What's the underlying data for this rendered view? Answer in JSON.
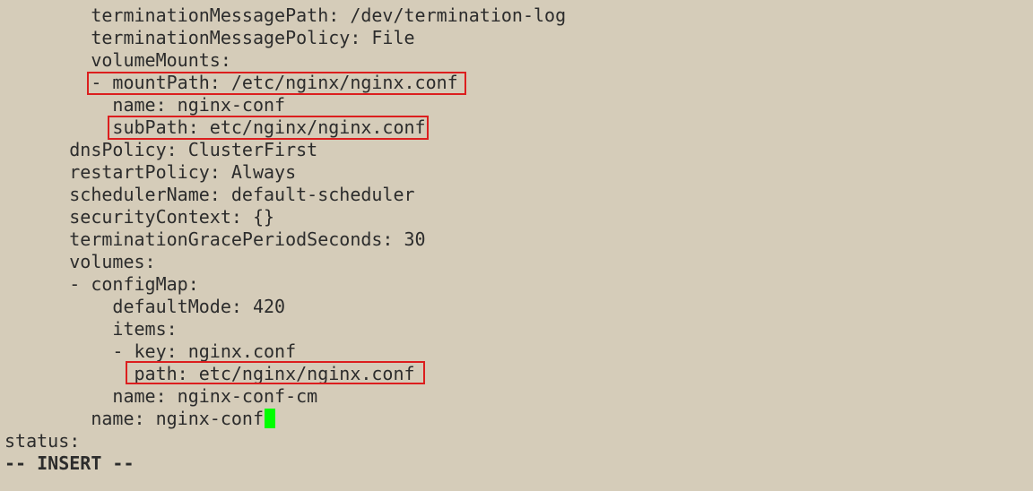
{
  "editor": {
    "lines": [
      "        terminationMessagePath: /dev/termination-log",
      "        terminationMessagePolicy: File",
      "        volumeMounts:",
      "        - mountPath: /etc/nginx/nginx.conf",
      "          name: nginx-conf",
      "          subPath: etc/nginx/nginx.conf",
      "      dnsPolicy: ClusterFirst",
      "      restartPolicy: Always",
      "      schedulerName: default-scheduler",
      "      securityContext: {}",
      "      terminationGracePeriodSeconds: 30",
      "      volumes:",
      "      - configMap:",
      "          defaultMode: 420",
      "          items:",
      "          - key: nginx.conf",
      "            path: etc/nginx/nginx.conf",
      "          name: nginx-conf-cm",
      "        name: nginx-conf",
      "status:"
    ],
    "mode_label": "-- INSERT --",
    "text_color": "#2c2c2c",
    "background_color": "#d5ccb9",
    "highlight_color": "#dc1e1e",
    "cursor_color": "#00ff00"
  }
}
